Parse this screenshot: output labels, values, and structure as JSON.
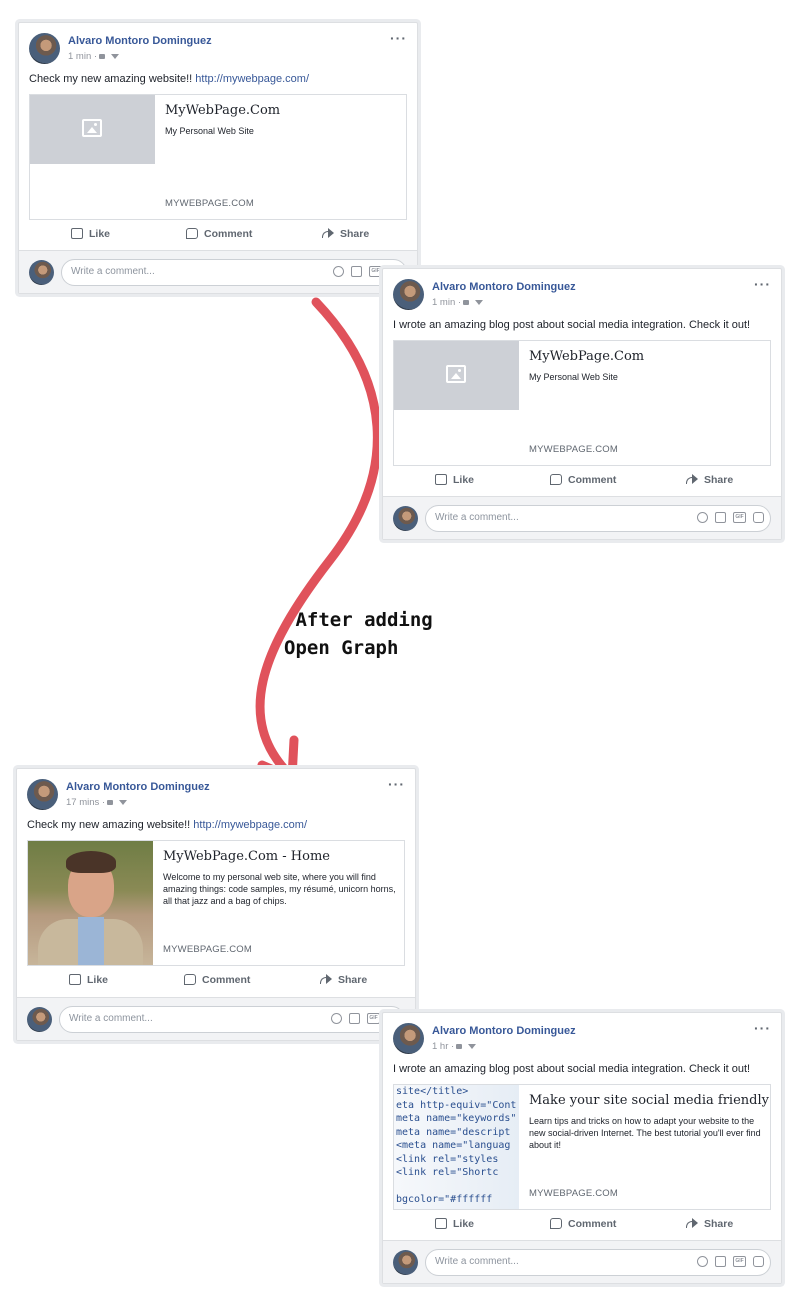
{
  "caption": {
    "line1": " After adding",
    "line2": "Open Graph"
  },
  "common": {
    "author": "Alvaro Montoro Dominguez",
    "more": "···",
    "like": "Like",
    "comment": "Comment",
    "share": "Share",
    "comment_placeholder": "Write a comment...",
    "gif": "GIF"
  },
  "posts": [
    {
      "time": "1 min ·",
      "text": "Check my new amazing website!! ",
      "link": "http://mywebpage.com/",
      "card": {
        "title": "MyWebPage.Com",
        "description": "My Personal Web Site",
        "domain": "MYWEBPAGE.COM",
        "image": "placeholder"
      }
    },
    {
      "time": "1 min ·",
      "text": "I wrote an amazing blog post about social media integration. Check it out!",
      "link": "",
      "card": {
        "title": "MyWebPage.Com",
        "description": "My Personal Web Site",
        "domain": "MYWEBPAGE.COM",
        "image": "placeholder"
      }
    },
    {
      "time": "17 mins ·",
      "text": "Check my new amazing website!! ",
      "link": "http://mywebpage.com/",
      "card": {
        "title": "MyWebPage.Com - Home",
        "description": "Welcome to my personal web site, where you will find amazing things: code samples, my résumé, unicorn horns, all that jazz and a bag of chips.",
        "domain": "MYWEBPAGE.COM",
        "image": "portrait-photo"
      }
    },
    {
      "time": "1 hr ·",
      "text": "I wrote an amazing blog post about social media integration. Check it out!",
      "link": "",
      "card": {
        "title": "Make your site social media friendly",
        "description": "Learn tips and tricks on how to adapt your website to the new social-driven Internet. The best tutorial you'll ever find about it!",
        "domain": "MYWEBPAGE.COM",
        "image": "code-screenshot"
      }
    }
  ],
  "code_lines": [
    "site</title>",
    "eta http-equiv=\"Cont",
    "meta name=\"keywords\"",
    "meta name=\"descript",
    "<meta name=\"languag",
    " <link rel=\"styles",
    " <link rel=\"Shortc",
    "",
    "bgcolor=\"#ffffff"
  ],
  "colors": {
    "arrow": "#e0525b",
    "link": "#385898"
  }
}
